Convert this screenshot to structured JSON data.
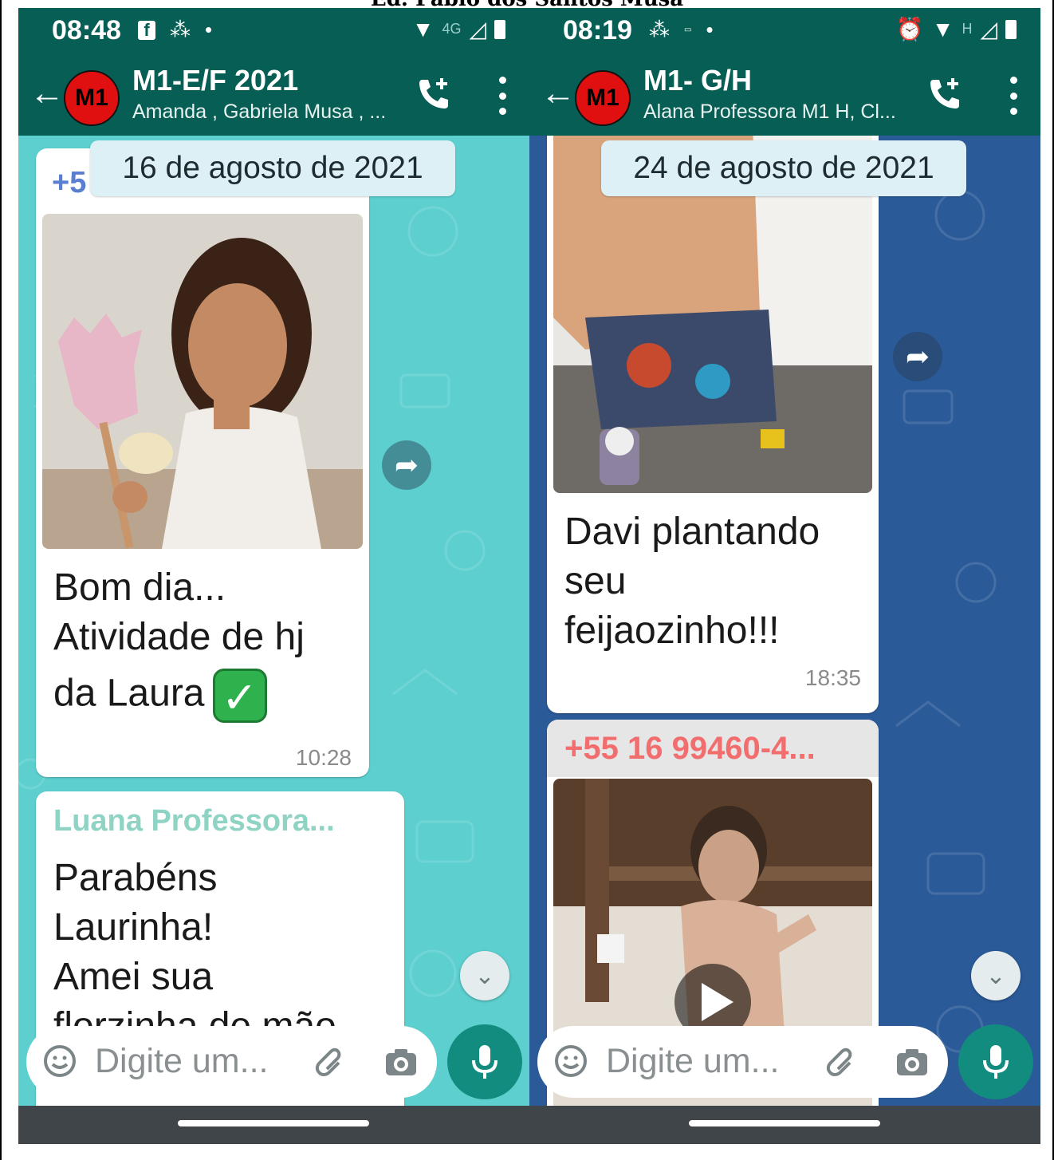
{
  "caption": "Ed. Pablo dos Santos Musa",
  "left_phone": {
    "status_time": "08:48",
    "status_network": "4G",
    "title": "M1-E/F  2021",
    "subtitle": "Amanda , Gabriela Musa , ...",
    "avatar_text": "M1",
    "date_chip": "16 de agosto de 2021",
    "sender_partial": "+5",
    "message1": {
      "line1": "Bom dia...",
      "line2": "Atividade de hj",
      "line3": "da Laura",
      "time": "10:28"
    },
    "message2": {
      "sender": "Luana Professora...",
      "line1": "Parabéns",
      "line2": "Laurinha!",
      "line3": "Amei sua",
      "line4": "florzinha de mão"
    },
    "input_placeholder": "Digite um...",
    "colors": {
      "chat_bg": "#5dcfcf",
      "header": "#075e54",
      "sender2": "#8fd3c4",
      "sender1": "#5b7fd0"
    }
  },
  "right_phone": {
    "status_time": "08:19",
    "status_network": "H",
    "title": "M1- G/H",
    "subtitle": "Alana Professora M1 H, Cl...",
    "avatar_text": "M1",
    "date_chip": "24 de agosto de 2021",
    "message1": {
      "line1": "Davi plantando",
      "line2": "seu",
      "line3": "feijaozinho!!!",
      "time": "18:35"
    },
    "message2": {
      "sender": "+55 16 99460-4..."
    },
    "input_placeholder": "Digite um...",
    "colors": {
      "chat_bg": "#2b5a99",
      "header": "#075e54",
      "sender2": "#f26d6d"
    }
  }
}
